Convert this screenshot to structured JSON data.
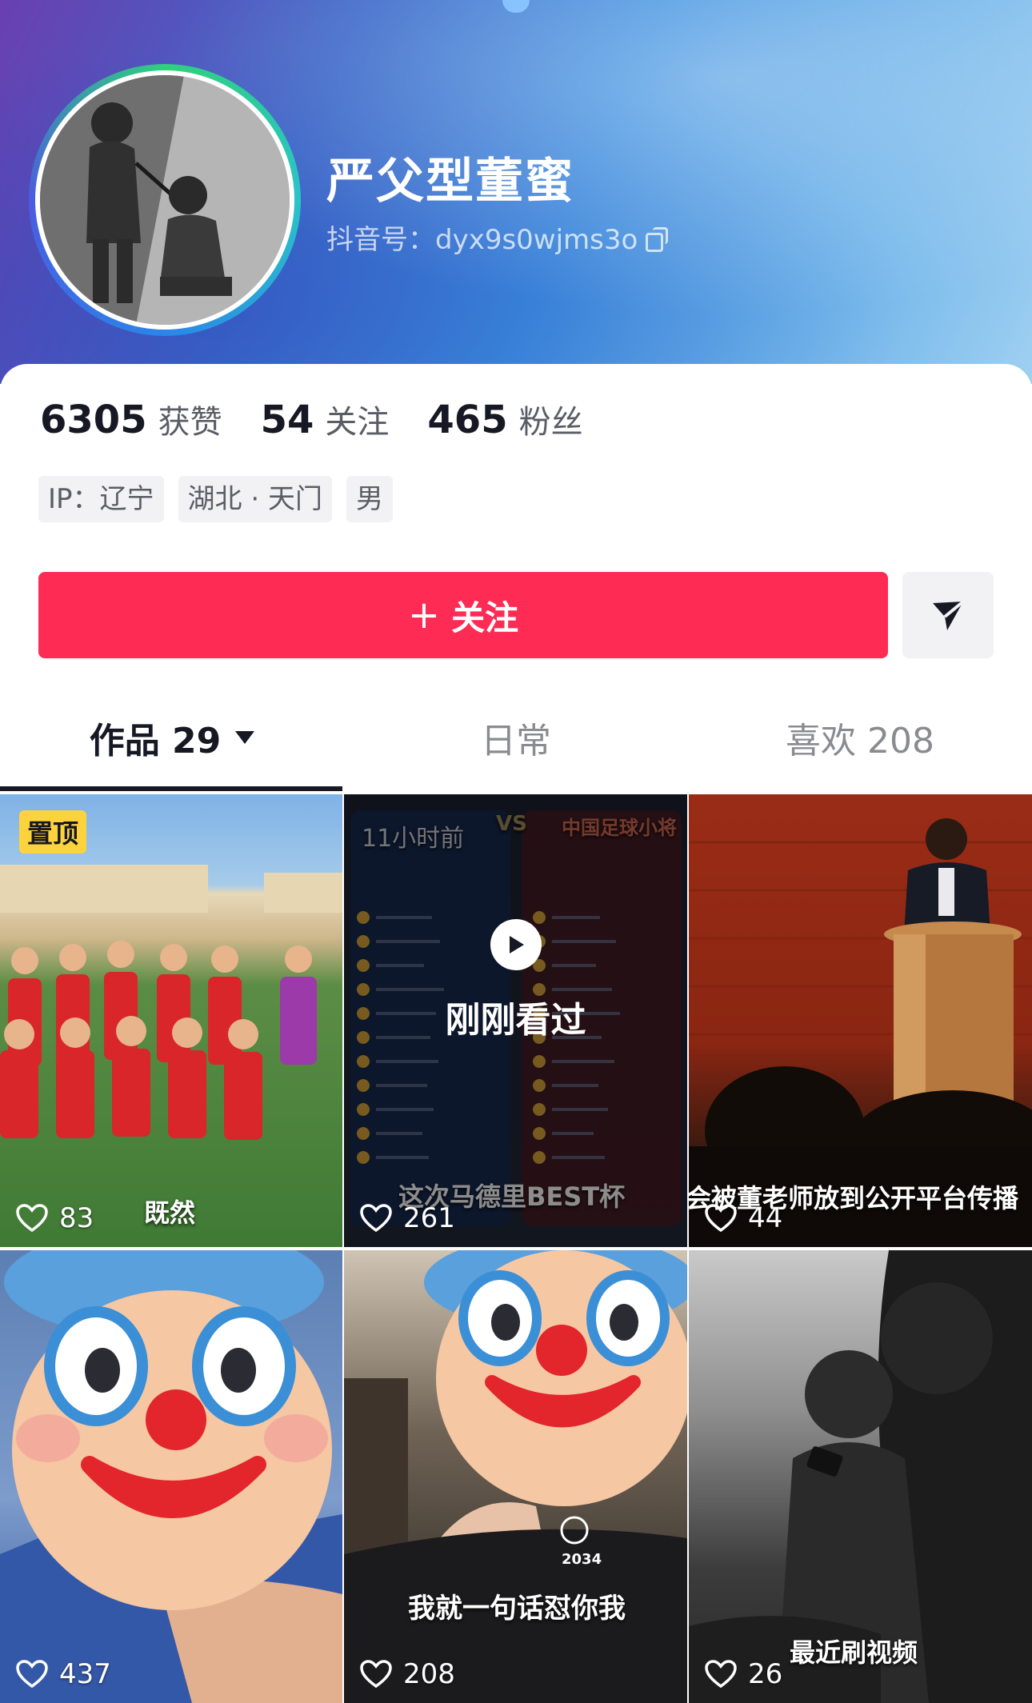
{
  "profile": {
    "username": "严父型董蜜",
    "douyin_id": "抖音号：dyx9s0wjms3o"
  },
  "stats": {
    "likes_count": "6305",
    "likes_label": "获赞",
    "following_count": "54",
    "following_label": "关注",
    "followers_count": "465",
    "followers_label": "粉丝"
  },
  "tags": [
    "IP：辽宁",
    "湖北 · 天门",
    "男"
  ],
  "actions": {
    "follow_plus": "+",
    "follow_label": "关注"
  },
  "tabs": [
    {
      "label": "作品 29"
    },
    {
      "label": "日常"
    },
    {
      "label": "喜欢 208"
    }
  ],
  "videos": [
    {
      "likes": "83",
      "badge": "置顶",
      "caption": "既然"
    },
    {
      "likes": "261",
      "overlay": "刚刚看过",
      "time": "11小时前",
      "caption": "这次马德里BEST杯",
      "vs": "VS",
      "right_title": "中国足球小将"
    },
    {
      "likes": "44",
      "caption": "会被董老师放到公开平台传播"
    },
    {
      "likes": "437"
    },
    {
      "likes": "208",
      "caption": "我就一句话怼你我"
    },
    {
      "likes": "26",
      "caption": "最近刷视频"
    }
  ],
  "colors": {
    "accent": "#fe2c55",
    "pinned_badge": "#fdd33d",
    "text_primary": "#161823"
  }
}
